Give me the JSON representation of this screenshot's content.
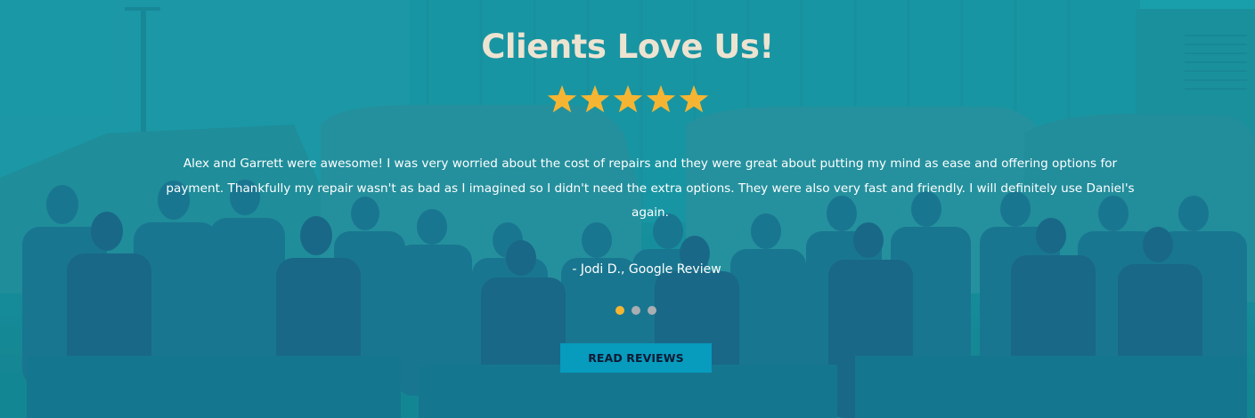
{
  "section": {
    "title": "Clients Love Us!",
    "rating_stars": 5,
    "star_color": "#f5b533",
    "accent_color": "#079bbe"
  },
  "review": {
    "text": "Alex and Garrett were awesome! I was very worried about the cost of repairs and they were great about putting my mind as ease and offering options for payment. Thankfully my repair wasn't as bad as I imagined so I didn't need the extra options. They were also very fast and friendly. I will definitely use Daniel's again.",
    "author": "- Jodi D., Google Review"
  },
  "carousel": {
    "slide_count": 3,
    "active_index": 0
  },
  "cta": {
    "label": "READ REVIEWS"
  }
}
